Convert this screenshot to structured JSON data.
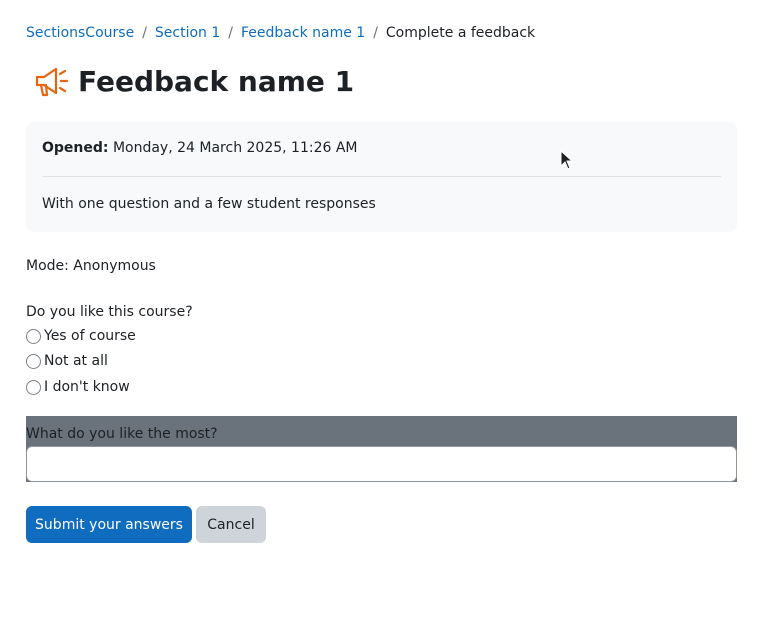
{
  "breadcrumb": {
    "items": [
      "SectionsCourse",
      "Section 1",
      "Feedback name 1"
    ],
    "separator": "/",
    "current": "Complete a feedback"
  },
  "page": {
    "title": "Feedback name 1",
    "icon": "megaphone-icon"
  },
  "info": {
    "opened_label": "Opened:",
    "opened_value": "Monday, 24 March 2025, 11:26 AM",
    "description": "With one question and a few student responses"
  },
  "mode": "Mode: Anonymous",
  "question1": {
    "label": "Do you like this course?",
    "options": [
      "Yes of course",
      "Not at all",
      "I don't know"
    ]
  },
  "question2": {
    "label": "What do you like the most?",
    "value": ""
  },
  "buttons": {
    "submit": "Submit your answers",
    "cancel": "Cancel"
  },
  "colors": {
    "link": "#0f6cbf",
    "primary": "#0f6cbf",
    "icon_accent": "#e8650e"
  }
}
